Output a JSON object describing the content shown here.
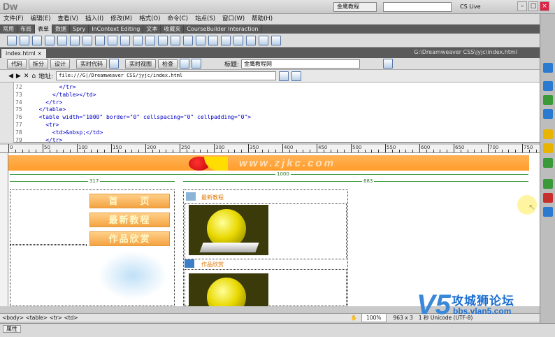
{
  "app": {
    "logo": "Dw",
    "workspace": "金鹰教程",
    "cs_live": "CS Live"
  },
  "menubar": [
    "文件(F)",
    "编辑(E)",
    "查看(V)",
    "插入(I)",
    "修改(M)",
    "格式(O)",
    "命令(C)",
    "站点(S)",
    "窗口(W)",
    "帮助(H)"
  ],
  "insert_tabs": [
    "常用",
    "布局",
    "表单",
    "数据",
    "Spry",
    "InContext Editing",
    "文本",
    "收藏夹",
    "CourseBuilder Interaction"
  ],
  "active_insert_tab": "表单",
  "document": {
    "tab": "index.html",
    "path": "G:\\Dreamweaver CSS\\jyjc\\index.html"
  },
  "doc_toolbar": {
    "code": "代码",
    "split": "拆分",
    "design": "设计",
    "live_code": "实时代码",
    "live_view": "实时视图",
    "inspect": "检查",
    "title_label": "标题:",
    "title_value": "金鹰教程网"
  },
  "address": {
    "label": "地址:",
    "value": "file:///G|/Dreamweaver CSS/jyjc/index.html"
  },
  "code_lines": [
    {
      "n": "72",
      "text": "        </tr>"
    },
    {
      "n": "73",
      "text": "      </table></td>"
    },
    {
      "n": "74",
      "text": "    </tr>"
    },
    {
      "n": "75",
      "text": "  </table>"
    },
    {
      "n": "76",
      "text": "  <table width=\"1000\" border=\"0\" cellspacing=\"0\" cellpadding=\"0\">"
    },
    {
      "n": "77",
      "text": "    <tr>"
    },
    {
      "n": "78",
      "text": "      <td>&nbsp;</td>"
    },
    {
      "n": "79",
      "text": "    </tr>"
    }
  ],
  "ruler_labels": [
    "0",
    "50",
    "100",
    "150",
    "200",
    "250",
    "300",
    "350",
    "400",
    "450",
    "500",
    "550",
    "600",
    "650",
    "700",
    "750"
  ],
  "design": {
    "banner_text": "www.zjkc.com",
    "width_total": "1000",
    "width_left": "317",
    "width_right": "683",
    "nav": [
      "首　　页",
      "最新教程",
      "作品欣赏"
    ],
    "section1": "最新教程",
    "section2": "作品欣赏"
  },
  "status": {
    "path": "<body> <table> <tr> <td>",
    "zoom": "100%",
    "size": "963 x 3",
    "encoding": "1 秒 Unicode (UTF-8)"
  },
  "props": {
    "tab": "属性"
  },
  "watermark": {
    "brand": "攻城狮论坛",
    "url": "bbs.vlan5.com"
  }
}
